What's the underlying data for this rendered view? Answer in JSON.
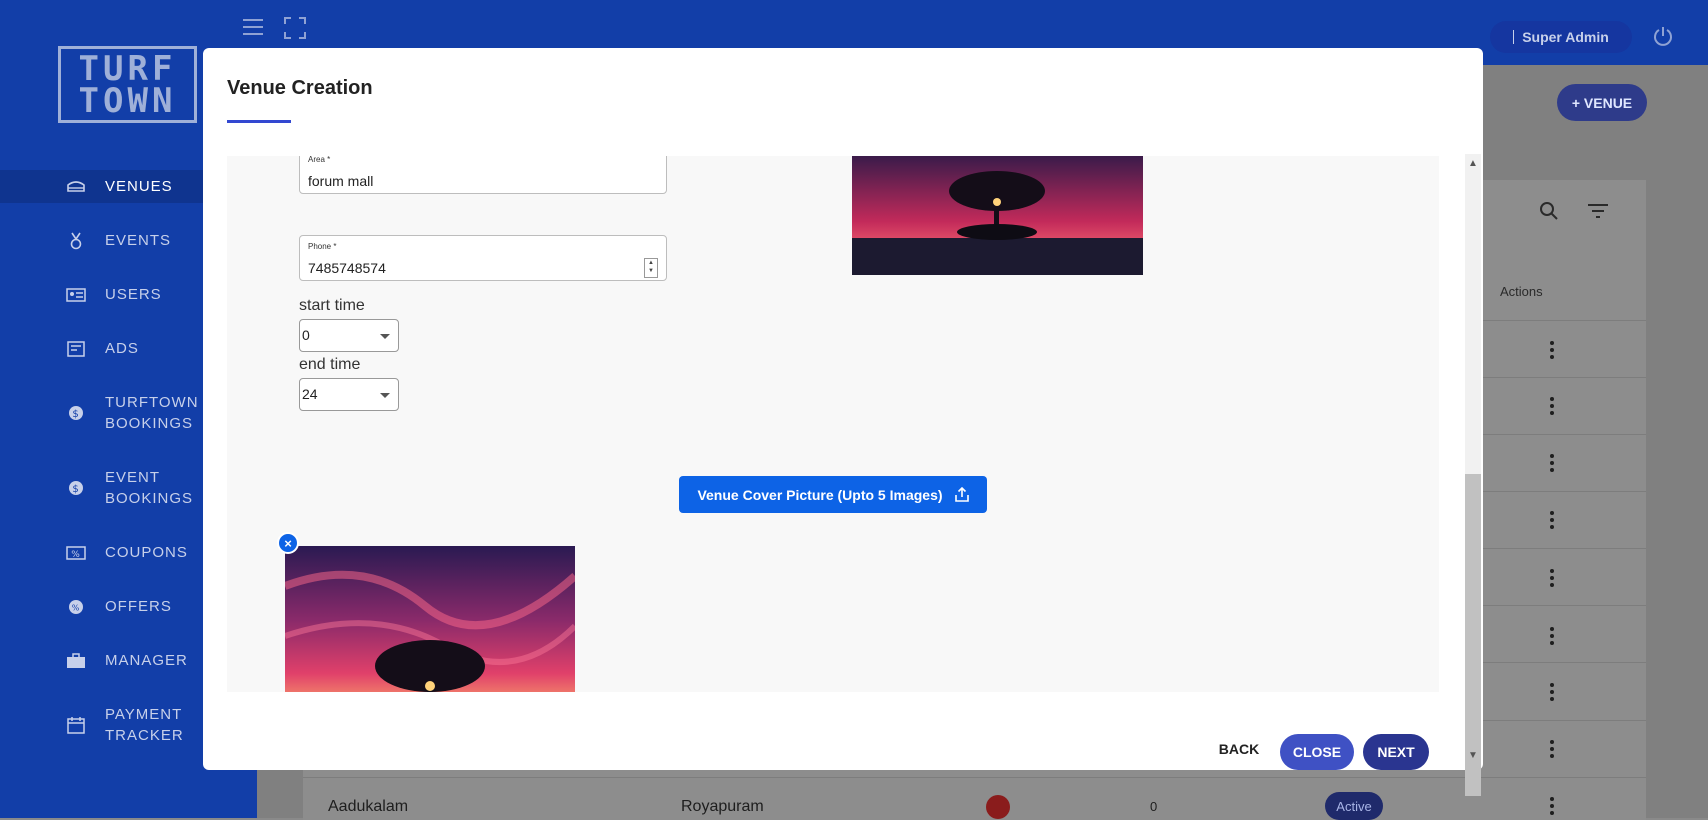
{
  "header": {
    "user_label": "Super Admin",
    "add_venue_label": "+ VENUE"
  },
  "sidebar": {
    "logo_line1": "TURF",
    "logo_line2": "TOWN",
    "items": [
      {
        "label": "VENUES",
        "icon": "stadium-icon"
      },
      {
        "label": "EVENTS",
        "icon": "medal-icon"
      },
      {
        "label": "USERS",
        "icon": "id-card-icon"
      },
      {
        "label": "ADS",
        "icon": "billboard-icon"
      },
      {
        "label_line1": "TURFTOWN",
        "label_line2": "BOOKINGS",
        "icon": "coin-icon"
      },
      {
        "label_line1": "EVENT",
        "label_line2": "BOOKINGS",
        "icon": "coin-icon"
      },
      {
        "label": "COUPONS",
        "icon": "coupon-icon"
      },
      {
        "label": "OFFERS",
        "icon": "offer-badge-icon"
      },
      {
        "label": "MANAGER",
        "icon": "briefcase-icon"
      },
      {
        "label_line1": "PAYMENT",
        "label_line2": "TRACKER",
        "icon": "calendar-icon"
      }
    ]
  },
  "table": {
    "actions_header": "Actions",
    "last_row": {
      "name": "Aadukalam",
      "area": "Royapuram",
      "count": "0",
      "status": "Active"
    }
  },
  "modal": {
    "title": "Venue Creation",
    "area": {
      "label": "Area *",
      "value": "forum mall"
    },
    "phone": {
      "label": "Phone *",
      "value": "7485748574"
    },
    "start_time": {
      "label": "start time",
      "value": "0"
    },
    "end_time": {
      "label": "end time",
      "value": "24"
    },
    "upload_button": "Venue Cover Picture (Upto 5 Images)",
    "remove_icon": "×",
    "back_label": "BACK",
    "close_label": "CLOSE",
    "next_label": "NEXT"
  },
  "colors": {
    "sidebar": "#123ea8",
    "primary_button": "#0d63e6",
    "close_button": "#3f51c4",
    "next_button": "#2a3590"
  }
}
